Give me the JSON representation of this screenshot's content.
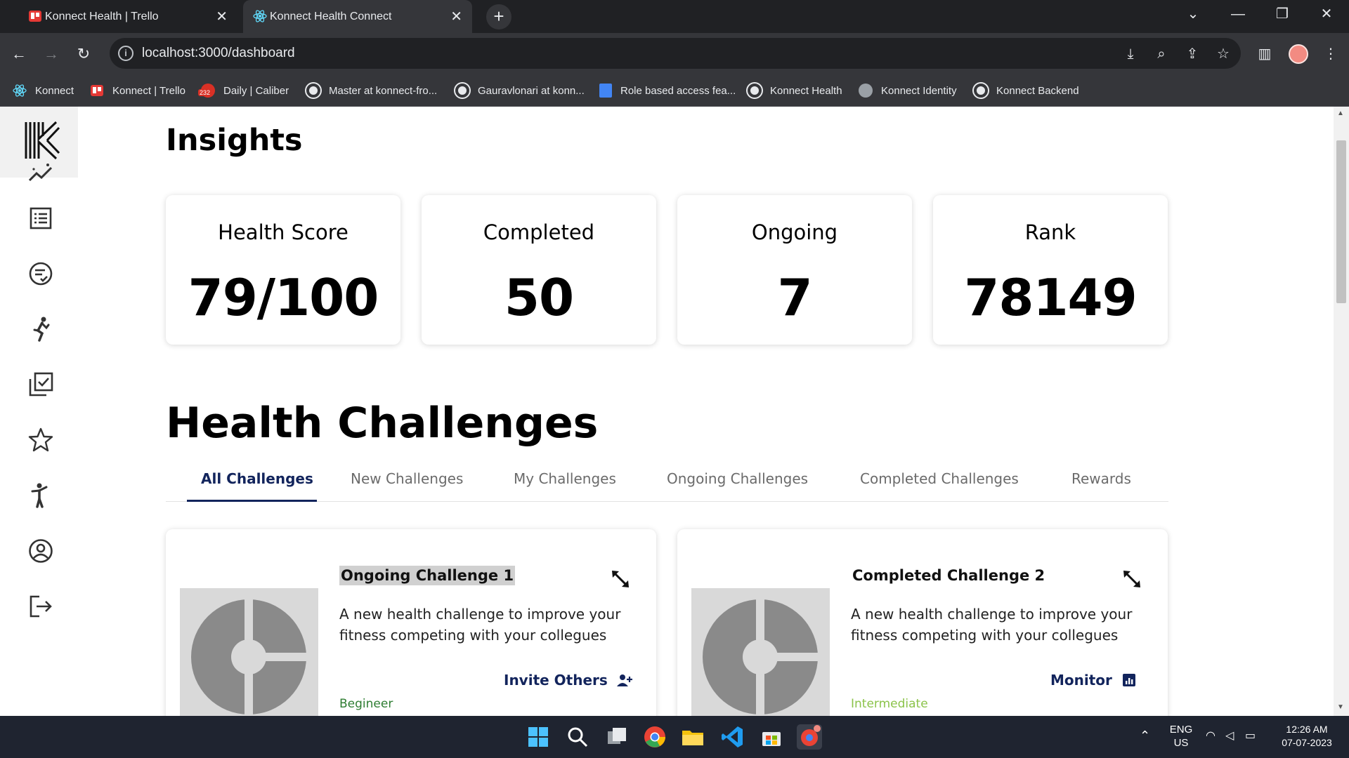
{
  "browser": {
    "tabs": [
      {
        "title": "Konnect Health | Trello",
        "active": false
      },
      {
        "title": "Konnect Health Connect",
        "active": true
      }
    ],
    "new_tab": "+",
    "url": "localhost:3000/dashboard",
    "bookmarks": [
      {
        "label": "Konnect",
        "icon": "react-icon"
      },
      {
        "label": "Konnect | Trello",
        "icon": "trello-icon"
      },
      {
        "label": "Daily | Caliber",
        "icon": "caliber-icon",
        "badge": "232"
      },
      {
        "label": "Master at konnect-fro...",
        "icon": "github-icon"
      },
      {
        "label": "Gauravlonari at konn...",
        "icon": "github-icon"
      },
      {
        "label": "Role based access fea...",
        "icon": "docs-icon"
      },
      {
        "label": "Konnect Health",
        "icon": "github-icon"
      },
      {
        "label": "Konnect Identity",
        "icon": "globe-icon"
      },
      {
        "label": "Konnect Backend",
        "icon": "github-icon"
      }
    ]
  },
  "sidebar": {
    "items": [
      {
        "name": "insights",
        "icon": "trend-icon"
      },
      {
        "name": "list",
        "icon": "list-icon"
      },
      {
        "name": "tasks",
        "icon": "checklist-icon"
      },
      {
        "name": "activity",
        "icon": "runner-icon"
      },
      {
        "name": "completed",
        "icon": "checkbox-stack-icon"
      },
      {
        "name": "rewards",
        "icon": "star-icon"
      },
      {
        "name": "fitness",
        "icon": "person-stretch-icon"
      },
      {
        "name": "profile",
        "icon": "account-circle-icon"
      },
      {
        "name": "logout",
        "icon": "logout-icon"
      }
    ]
  },
  "insights": {
    "title": "Insights",
    "cards": [
      {
        "label": "Health Score",
        "value": "79/100"
      },
      {
        "label": "Completed",
        "value": "50"
      },
      {
        "label": "Ongoing",
        "value": "7"
      },
      {
        "label": "Rank",
        "value": "78149"
      }
    ]
  },
  "challenges": {
    "title": "Health Challenges",
    "tabs": [
      "All Challenges",
      "New Challenges",
      "My Challenges",
      "Ongoing Challenges",
      "Completed Challenges",
      "Rewards"
    ],
    "active_tab": "All Challenges",
    "cards": [
      {
        "title": "Ongoing Challenge 1",
        "description": "A new health challenge to improve your fitness competing with your collegues",
        "action": "Invite Others",
        "action_icon": "add-person-icon",
        "level": "Begineer",
        "level_color": "#2e7d32"
      },
      {
        "title": "Completed Challenge 2",
        "description": "A new health challenge to improve your fitness competing with your collegues",
        "action": "Monitor",
        "action_icon": "bar-chart-icon",
        "level": "Intermediate",
        "level_color": "#8bc34a"
      }
    ]
  },
  "colors": {
    "accent": "#12245c",
    "chrome_bg": "#202124",
    "chrome_toolbar": "#35363a",
    "taskbar": "#1f2430"
  },
  "taskbar": {
    "lang_top": "ENG",
    "lang_bottom": "US",
    "time": "12:26 AM",
    "date": "07-07-2023"
  }
}
